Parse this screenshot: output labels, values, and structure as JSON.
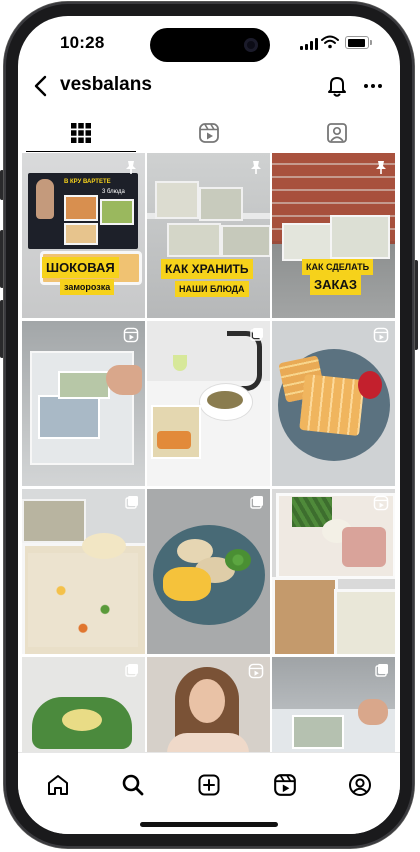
{
  "status_bar": {
    "time": "10:28"
  },
  "header": {
    "username": "vesbalans"
  },
  "tabs": [
    {
      "name": "posts",
      "icon": "grid-icon",
      "active": true
    },
    {
      "name": "reels",
      "icon": "reels-icon",
      "active": false
    },
    {
      "name": "tagged",
      "icon": "tagged-icon",
      "active": false
    }
  ],
  "posts": {
    "p1": {
      "badge": "pin-icon",
      "line1": "ШОКОВАЯ",
      "line2": "заморозка",
      "poster_head": "В КРУ ВАРТЕТЕ",
      "poster_sub": "3 блюда"
    },
    "p2": {
      "badge": "pin-icon",
      "line1": "КАК ХРАНИТЬ",
      "line2": "НАШИ БЛЮДА"
    },
    "p3": {
      "badge": "pin-icon",
      "line1": "КАК СДЕЛАТЬ",
      "line2": "ЗАКАЗ"
    },
    "p4": {
      "badge": "reels-icon"
    },
    "p5": {
      "badge": "multi-icon"
    },
    "p6": {
      "badge": "reels-icon"
    },
    "p7": {
      "badge": "multi-icon"
    },
    "p8": {
      "badge": "multi-icon"
    },
    "p9": {
      "badge": "reels-icon"
    },
    "p10": {
      "badge": "multi-icon"
    },
    "p11": {
      "badge": "reels-icon"
    },
    "p12": {
      "badge": "multi-icon"
    }
  },
  "bottom_nav": [
    "home-icon",
    "search-icon",
    "create-icon",
    "reels-icon",
    "profile-icon"
  ],
  "colors": {
    "banner_yellow": "#f6d21b",
    "text": "#000000"
  }
}
